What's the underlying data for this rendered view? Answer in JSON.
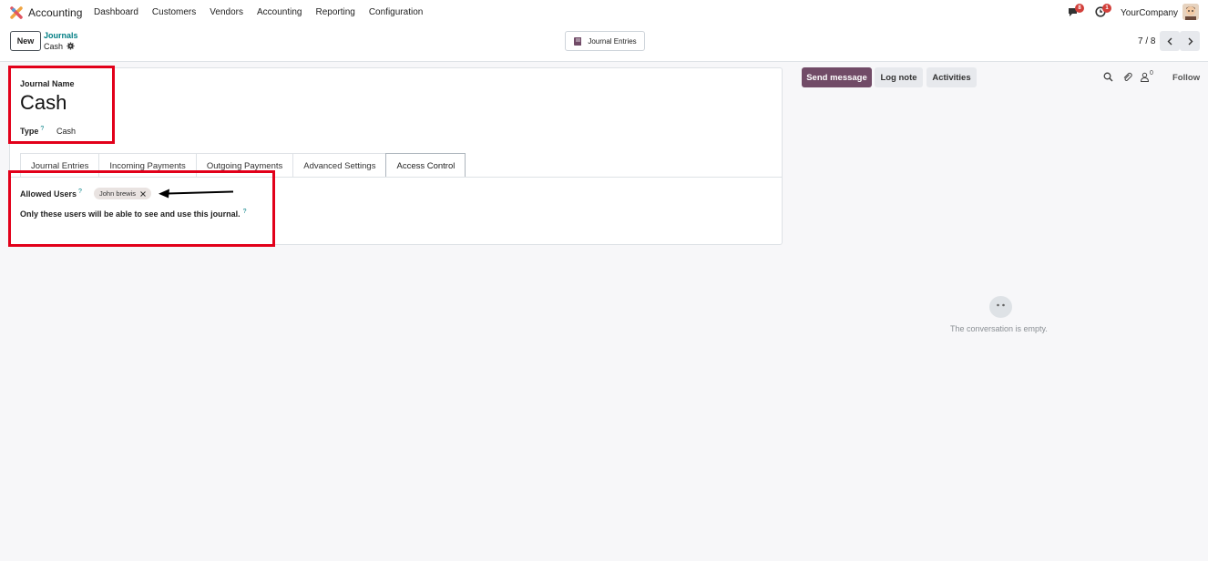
{
  "navbar": {
    "app_name": "Accounting",
    "menu": [
      "Dashboard",
      "Customers",
      "Vendors",
      "Accounting",
      "Reporting",
      "Configuration"
    ],
    "chat_badge": "8",
    "activity_badge": "1",
    "company": "YourCompany"
  },
  "control": {
    "new_label": "New",
    "breadcrumb_parent": "Journals",
    "breadcrumb_current": "Cash",
    "smart_button_label": "Journal Entries",
    "pager": "7 / 8"
  },
  "form": {
    "journal_name_label": "Journal Name",
    "journal_name_value": "Cash",
    "type_label": "Type",
    "type_help": "?",
    "type_value": "Cash",
    "tabs": [
      "Journal Entries",
      "Incoming Payments",
      "Outgoing Payments",
      "Advanced Settings",
      "Access Control"
    ],
    "active_tab": "Access Control",
    "allowed_users_label": "Allowed Users",
    "allowed_users_help": "?",
    "allowed_user_tag": "John brewis",
    "restriction_text": "Only these users will be able to see and use this journal.",
    "restriction_help": "?"
  },
  "chatter": {
    "send_message": "Send message",
    "log_note": "Log note",
    "activities": "Activities",
    "followers_count": "0",
    "follow": "Follow",
    "empty_text": "The conversation is empty."
  },
  "colors": {
    "brand": "#714b67",
    "link": "#017e84",
    "highlight": "#e2001a",
    "badge": "#d23f3a"
  }
}
